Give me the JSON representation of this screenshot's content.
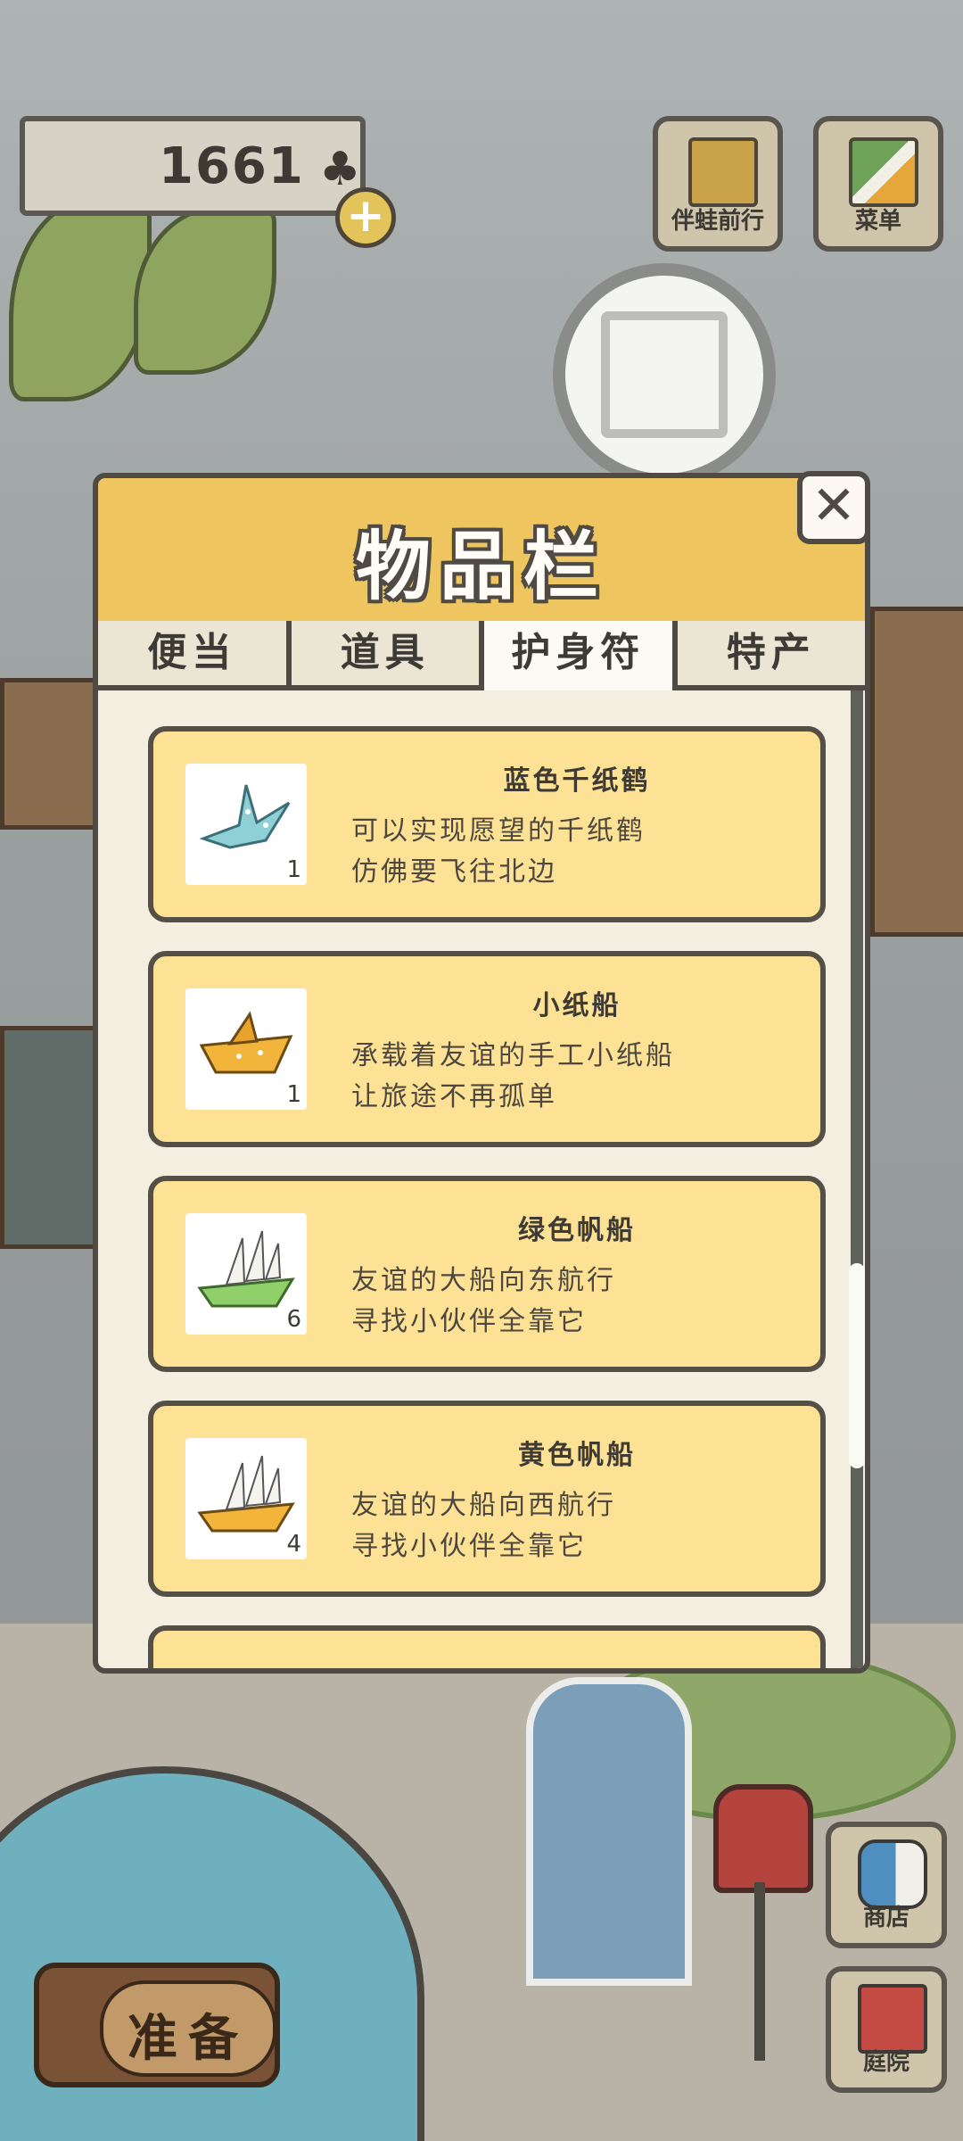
{
  "currency": {
    "value": "1661",
    "icon": "clover-icon"
  },
  "top_buttons": [
    {
      "label": "伴蛙前行",
      "icon": "frog-photo-icon"
    },
    {
      "label": "菜单",
      "icon": "menu-cards-icon"
    }
  ],
  "inventory": {
    "title": "物品栏",
    "close_label": "✕",
    "tabs": [
      {
        "label": "便当",
        "active": false
      },
      {
        "label": "道具",
        "active": false
      },
      {
        "label": "护身符",
        "active": true
      },
      {
        "label": "特产",
        "active": false
      }
    ],
    "items": [
      {
        "name": "蓝色千纸鹤",
        "desc1": "可以实现愿望的千纸鹤",
        "desc2": "仿佛要飞往北边",
        "count": "1",
        "icon": "blue-paper-crane-icon"
      },
      {
        "name": "小纸船",
        "desc1": "承载着友谊的手工小纸船",
        "desc2": "让旅途不再孤单",
        "count": "1",
        "icon": "paper-boat-icon"
      },
      {
        "name": "绿色帆船",
        "desc1": "友谊的大船向东航行",
        "desc2": "寻找小伙伴全靠它",
        "count": "6",
        "icon": "green-sailboat-icon"
      },
      {
        "name": "黄色帆船",
        "desc1": "友谊的大船向西航行",
        "desc2": "寻找小伙伴全靠它",
        "count": "4",
        "icon": "yellow-sailboat-icon"
      }
    ],
    "scroll_position": 0.72
  },
  "bottom_buttons": {
    "prepare": "准备",
    "shop": "商店",
    "yard": "庭院"
  },
  "colors": {
    "panel_header": "#efc560",
    "item_card": "#fde296",
    "outline": "#4f4a44"
  }
}
